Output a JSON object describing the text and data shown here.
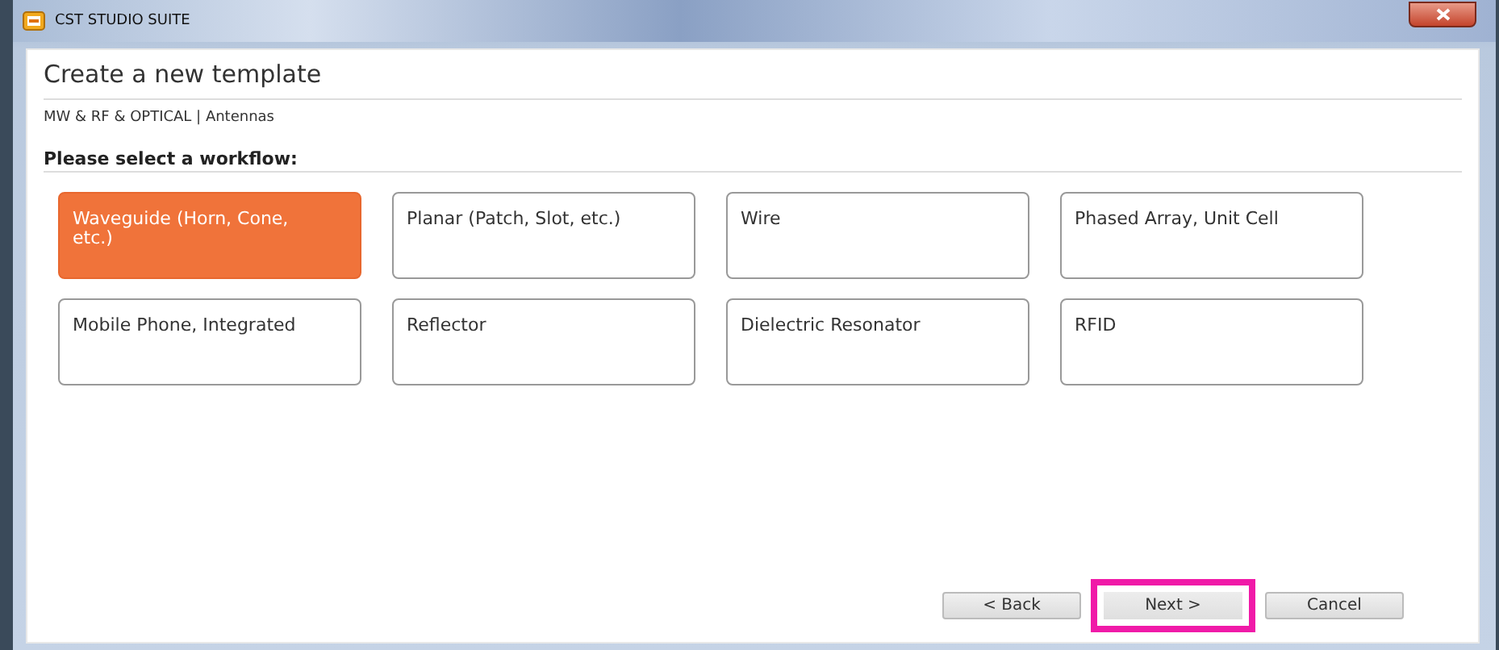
{
  "window": {
    "title": "CST STUDIO SUITE"
  },
  "heading": "Create a new template",
  "breadcrumb": "MW & RF & OPTICAL | Antennas",
  "prompt": "Please select a workflow:",
  "workflows": [
    {
      "label": "Waveguide (Horn, Cone, etc.)",
      "selected": true
    },
    {
      "label": "Planar (Patch, Slot, etc.)",
      "selected": false
    },
    {
      "label": "Wire",
      "selected": false
    },
    {
      "label": "Phased Array, Unit Cell",
      "selected": false
    },
    {
      "label": "Mobile Phone, Integrated",
      "selected": false
    },
    {
      "label": "Reflector",
      "selected": false
    },
    {
      "label": "Dielectric Resonator",
      "selected": false
    },
    {
      "label": "RFID",
      "selected": false
    }
  ],
  "buttons": [
    {
      "label": "< Back",
      "highlighted": false
    },
    {
      "label": "Next >",
      "highlighted": true
    },
    {
      "label": "Cancel",
      "highlighted": false
    }
  ]
}
